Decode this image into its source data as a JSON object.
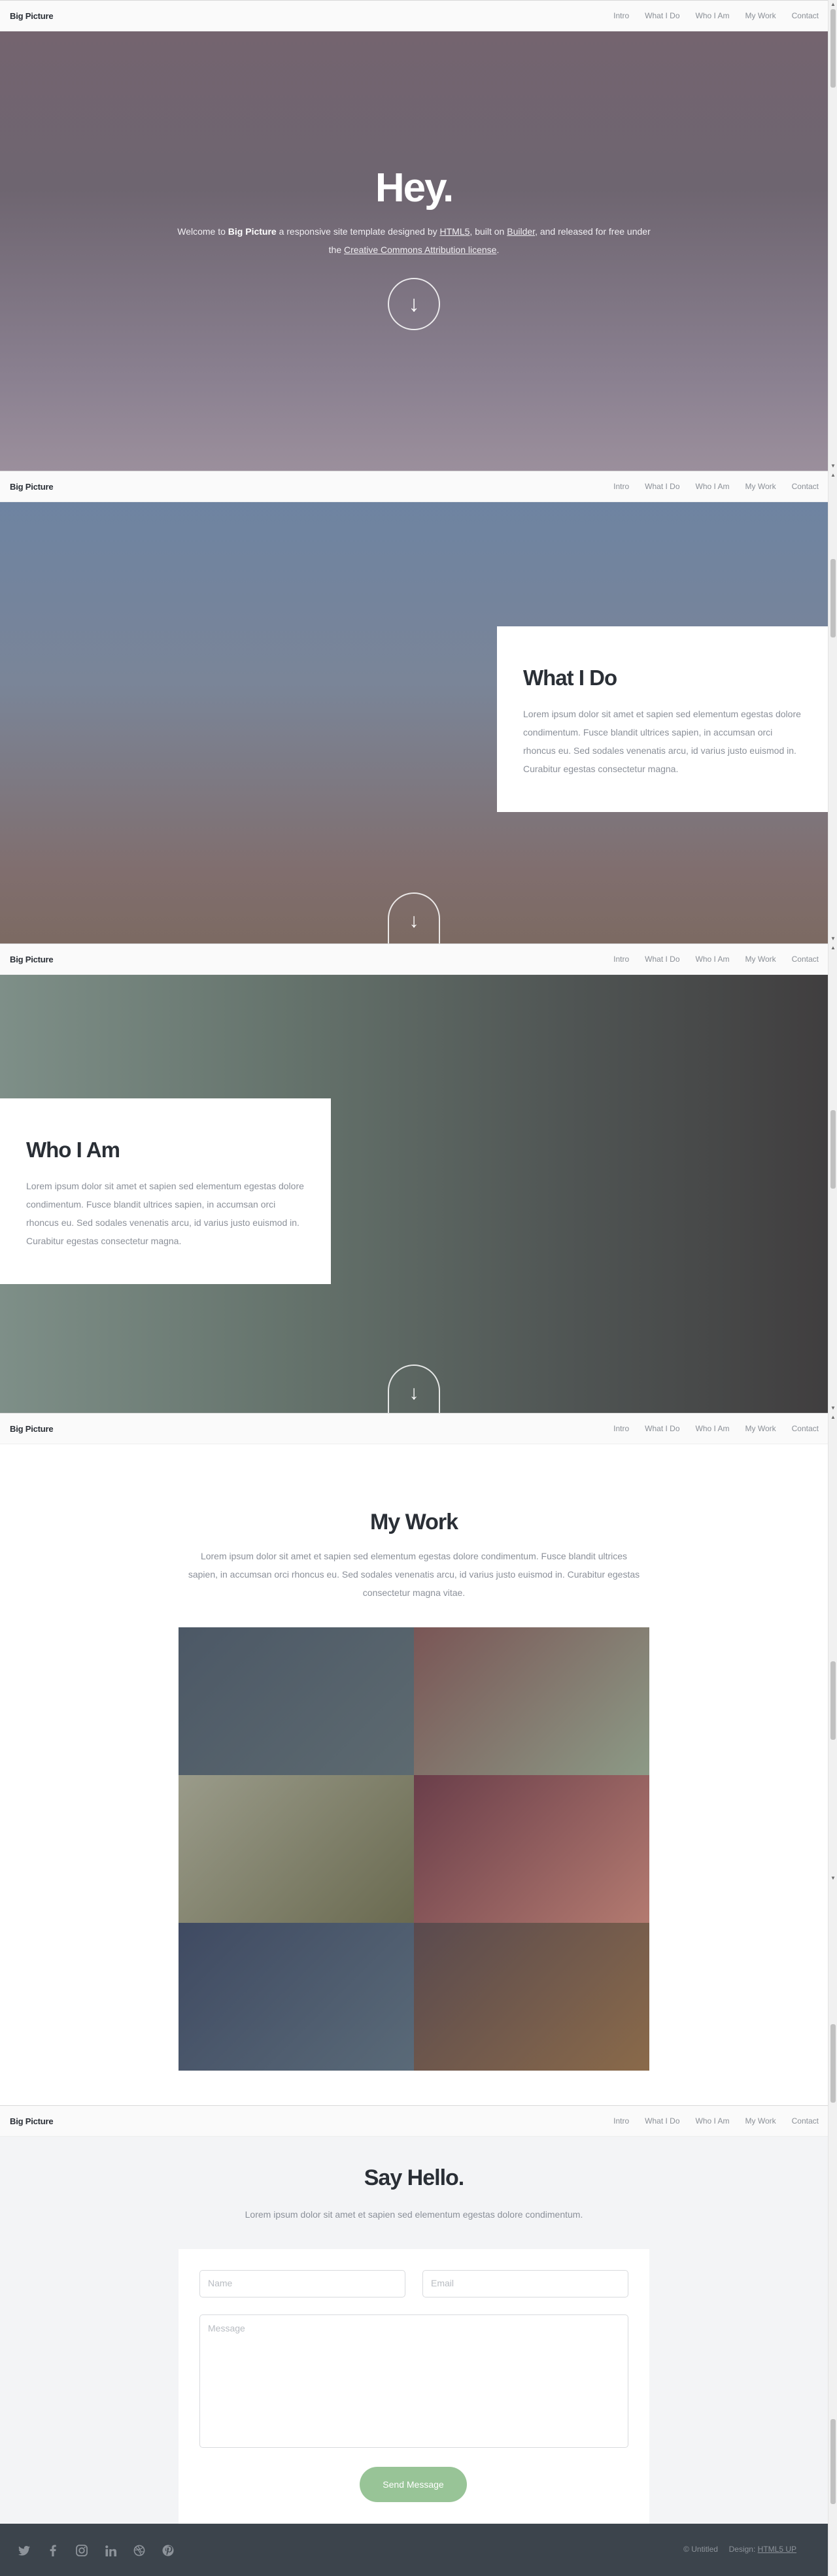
{
  "nav": {
    "brand": "Big Picture",
    "links": [
      "Intro",
      "What I Do",
      "Who I Am",
      "My Work",
      "Contact"
    ]
  },
  "intro": {
    "title": "Hey.",
    "text_before": "Welcome to ",
    "brand_bold": "Big Picture",
    "text_mid1": " a responsive site template designed by ",
    "link_html5": "HTML5",
    "text_mid2": ", built on ",
    "link_skel": "Builder",
    "text_mid3": ", and released for free under the ",
    "link_license": "Creative Commons Attribution license",
    "text_end": "."
  },
  "what_i_do": {
    "title": "What I Do",
    "body": "Lorem ipsum dolor sit amet et sapien sed elementum egestas dolore condimentum. Fusce blandit ultrices sapien, in accumsan orci rhoncus eu. Sed sodales venenatis arcu, id varius justo euismod in. Curabitur egestas consectetur magna."
  },
  "who_i_am": {
    "title": "Who I Am",
    "body": "Lorem ipsum dolor sit amet et sapien sed elementum egestas dolore condimentum. Fusce blandit ultrices sapien, in accumsan orci rhoncus eu. Sed sodales venenatis arcu, id varius justo euismod in. Curabitur egestas consectetur magna."
  },
  "my_work": {
    "title": "My Work",
    "body": "Lorem ipsum dolor sit amet et sapien sed elementum egestas dolore condimentum. Fusce blandit ultrices sapien, in accumsan orci rhoncus eu. Sed sodales venenatis arcu, id varius justo euismod in. Curabitur egestas consectetur magna vitae.",
    "tile_colors": [
      [
        "#4c5866",
        "#5d6a70"
      ],
      [
        "#7a5656",
        "#8c9a86"
      ],
      [
        "#9a9b8a",
        "#6a6a50"
      ],
      [
        "#6a3e4a",
        "#b37a70"
      ],
      [
        "#3f4a62",
        "#5a6a78"
      ],
      [
        "#5a4a4e",
        "#8a6a4a"
      ]
    ]
  },
  "contact": {
    "title": "Say Hello.",
    "subtitle": "Lorem ipsum dolor sit amet et sapien sed elementum egestas dolore condimentum.",
    "name_placeholder": "Name",
    "email_placeholder": "Email",
    "message_placeholder": "Message",
    "submit_label": "Send Message"
  },
  "footer": {
    "social_icons": [
      "twitter-icon",
      "facebook-icon",
      "instagram-icon",
      "linkedin-icon",
      "dribbble-icon",
      "pinterest-icon"
    ],
    "copyright": "© Untitled",
    "design_label": "Design: ",
    "design_link": "HTML5 UP"
  },
  "colors": {
    "accent_green": "#98c497",
    "footer_bg": "#3c444c"
  }
}
